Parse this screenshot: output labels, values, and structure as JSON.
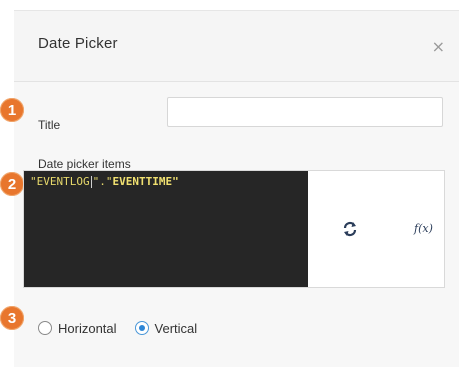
{
  "dialog": {
    "title": "Date Picker",
    "close_glyph": "×"
  },
  "annotations": [
    "1",
    "2",
    "3"
  ],
  "form": {
    "title_label": "Title",
    "title_value": "",
    "items_label": "Date picker items",
    "code_part1": "\"EVENTLOG",
    "code_part2": "\".\"",
    "code_part3": "EVENTTIME\"",
    "refresh_icon": "refresh-icon",
    "function_icon": "function-icon",
    "function_glyph": "f(x)",
    "orientation": {
      "options": [
        "Horizontal",
        "Vertical"
      ],
      "selected": "Vertical"
    }
  },
  "colors": {
    "badge": "#e8762d",
    "code_bg": "#262626",
    "code_text": "#e6d86b",
    "radio_selected": "#2e86d6",
    "panel_bg": "#f5f5f5"
  }
}
